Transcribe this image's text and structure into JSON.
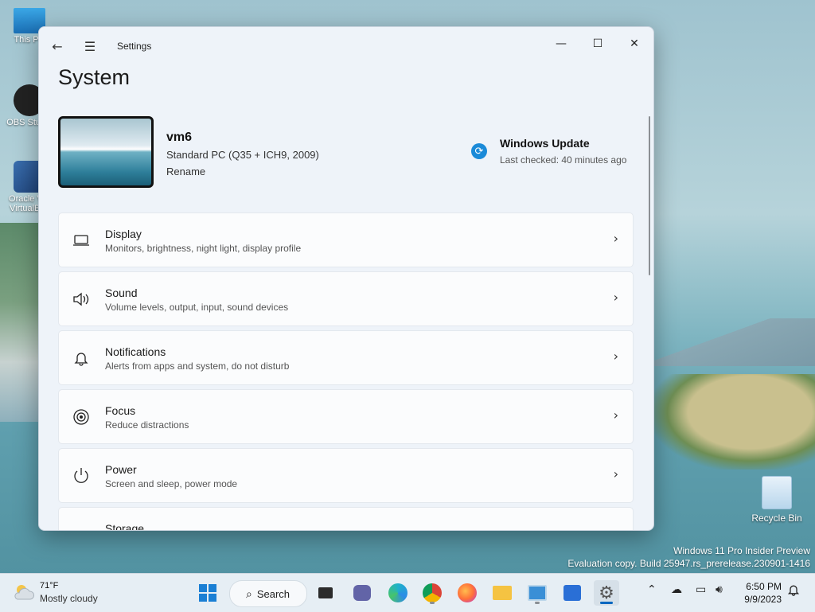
{
  "desktop": {
    "icons": [
      {
        "label": "This PC",
        "icon": "monitor-icon"
      },
      {
        "label": "OBS Studio",
        "icon": "obs-icon"
      },
      {
        "label": "Oracle VM VirtualBox",
        "icon": "virtualbox-icon"
      }
    ],
    "recycle_bin": {
      "label": "Recycle Bin",
      "icon": "recycle-bin-icon"
    },
    "watermark": {
      "line1": "Windows 11 Pro Insider Preview",
      "line2": "Evaluation copy. Build 25947.rs_prerelease.230901-1416"
    }
  },
  "window": {
    "app_title": "Settings",
    "controls": {
      "minimize": "—",
      "maximize": "☐",
      "close": "✕"
    },
    "page_title": "System",
    "device": {
      "name": "vm6",
      "model": "Standard PC (Q35 + ICH9, 2009)",
      "rename_label": "Rename"
    },
    "windows_update": {
      "title": "Windows Update",
      "status": "Last checked: 40 minutes ago"
    },
    "items": [
      {
        "title": "Display",
        "subtitle": "Monitors, brightness, night light, display profile",
        "icon": "laptop-icon"
      },
      {
        "title": "Sound",
        "subtitle": "Volume levels, output, input, sound devices",
        "icon": "speaker-icon"
      },
      {
        "title": "Notifications",
        "subtitle": "Alerts from apps and system, do not disturb",
        "icon": "bell-icon"
      },
      {
        "title": "Focus",
        "subtitle": "Reduce distractions",
        "icon": "focus-icon"
      },
      {
        "title": "Power",
        "subtitle": "Screen and sleep, power mode",
        "icon": "power-icon"
      },
      {
        "title": "Storage",
        "subtitle": "",
        "icon": "drive-icon"
      }
    ]
  },
  "taskbar": {
    "weather": {
      "temp": "71°F",
      "desc": "Mostly cloudy"
    },
    "search_label": "Search",
    "clock": {
      "time": "6:50 PM",
      "date": "9/9/2023"
    }
  }
}
